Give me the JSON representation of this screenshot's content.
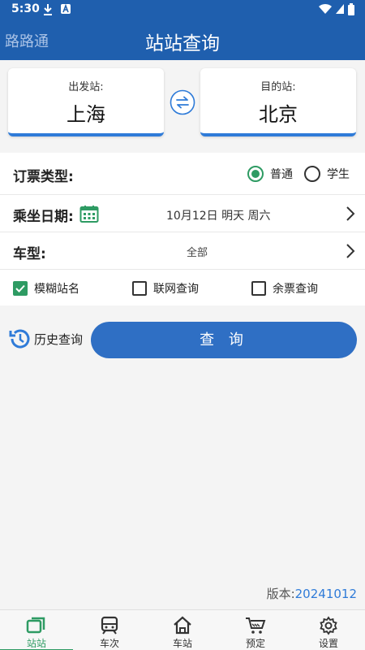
{
  "status": {
    "time": "5:30"
  },
  "header": {
    "app_name": "路路通",
    "title": "站站查询"
  },
  "stations": {
    "from_label": "出发站:",
    "from": "上海",
    "to_label": "目的站:",
    "to": "北京"
  },
  "ticket_type": {
    "label": "订票类型:",
    "options": [
      "普通",
      "学生"
    ],
    "selected": "普通"
  },
  "date": {
    "label": "乘坐日期:",
    "value": "10月12日 明天 周六"
  },
  "train_type": {
    "label": "车型:",
    "value": "全部"
  },
  "options": [
    {
      "label": "模糊站名",
      "checked": true
    },
    {
      "label": "联网查询",
      "checked": false
    },
    {
      "label": "余票查询",
      "checked": false
    }
  ],
  "actions": {
    "history": "历史查询",
    "query": "查 询"
  },
  "version": {
    "label": "版本:",
    "number": "20241012"
  },
  "tabs": [
    {
      "label": "站站",
      "icon": "station-pair-icon",
      "active": true
    },
    {
      "label": "车次",
      "icon": "train-icon",
      "active": false
    },
    {
      "label": "车站",
      "icon": "home-icon",
      "active": false
    },
    {
      "label": "预定",
      "icon": "cart-icon",
      "active": false
    },
    {
      "label": "设置",
      "icon": "gear-icon",
      "active": false
    }
  ],
  "colors": {
    "primary": "#1f5fae",
    "accent": "#2e9b63",
    "button": "#2f6fc4"
  }
}
